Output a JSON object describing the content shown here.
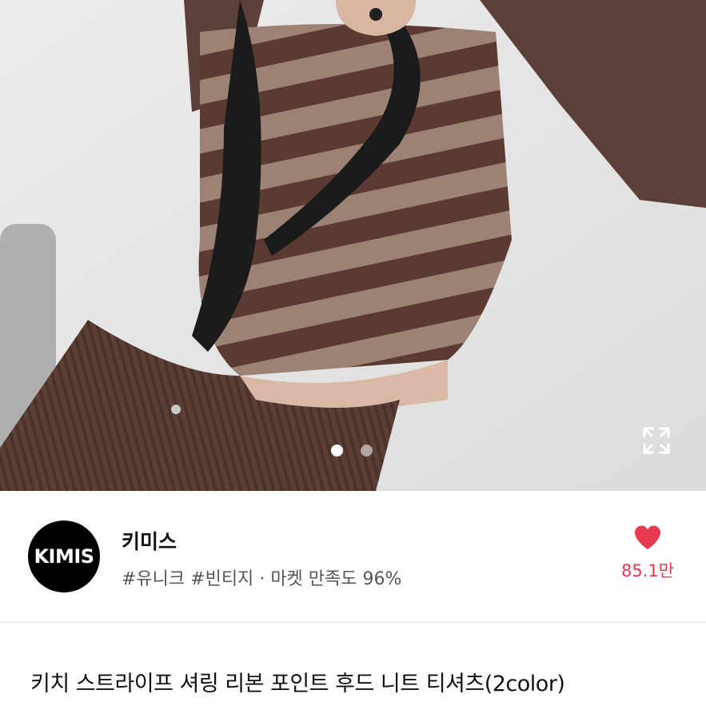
{
  "product_image": {
    "alt": "",
    "slide_count": 2,
    "active_slide": 1,
    "icons": {
      "expand": "expand-icon"
    }
  },
  "shop": {
    "logo_text": "KIMIS",
    "name": "키미스",
    "tags": "#유니크 #빈티지",
    "separator": "·",
    "satisfaction": "마켓 만족도 96%",
    "like_count": "85.1만",
    "icons": {
      "like": "heart-icon"
    },
    "colors": {
      "accent": "#e8394f",
      "logo_bg": "#000000"
    }
  },
  "product": {
    "title": "키치 스트라이프 셔링 리본 포인트 후드 니트 티셔츠(2color)"
  }
}
